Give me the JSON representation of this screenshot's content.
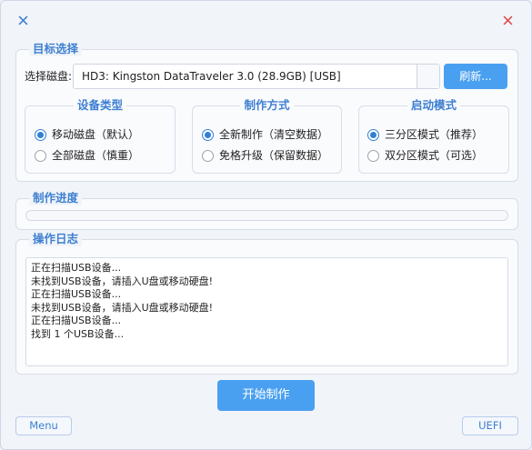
{
  "window": {
    "menu_icon": "x-icon-blue",
    "close_icon": "x-icon-red",
    "accent": "#4aa0f0"
  },
  "target": {
    "title": "目标选择",
    "disk_label": "选择磁盘:",
    "disk_value": "HD3: Kingston DataTraveler 3.0 (28.9GB) [USB]",
    "refresh_label": "刷新..."
  },
  "device_type": {
    "title": "设备类型",
    "options": [
      {
        "label": "移动磁盘（默认）",
        "selected": true
      },
      {
        "label": "全部磁盘（慎重）",
        "selected": false
      }
    ]
  },
  "make_mode": {
    "title": "制作方式",
    "options": [
      {
        "label": "全新制作（清空数据）",
        "selected": true
      },
      {
        "label": "免格升级（保留数据）",
        "selected": false
      }
    ]
  },
  "boot_mode": {
    "title": "启动模式",
    "options": [
      {
        "label": "三分区模式（推荐）",
        "selected": true
      },
      {
        "label": "双分区模式（可选）",
        "selected": false
      }
    ]
  },
  "progress": {
    "title": "制作进度",
    "value": 0
  },
  "log": {
    "title": "操作日志",
    "lines": [
      "正在扫描USB设备...",
      "未找到USB设备，请插入U盘或移动硬盘!",
      "正在扫描USB设备...",
      "未找到USB设备，请插入U盘或移动硬盘!",
      "正在扫描USB设备...",
      "找到 1 个USB设备..."
    ]
  },
  "actions": {
    "start_label": "开始制作",
    "menu_label": "Menu",
    "uefi_label": "UEFI"
  }
}
